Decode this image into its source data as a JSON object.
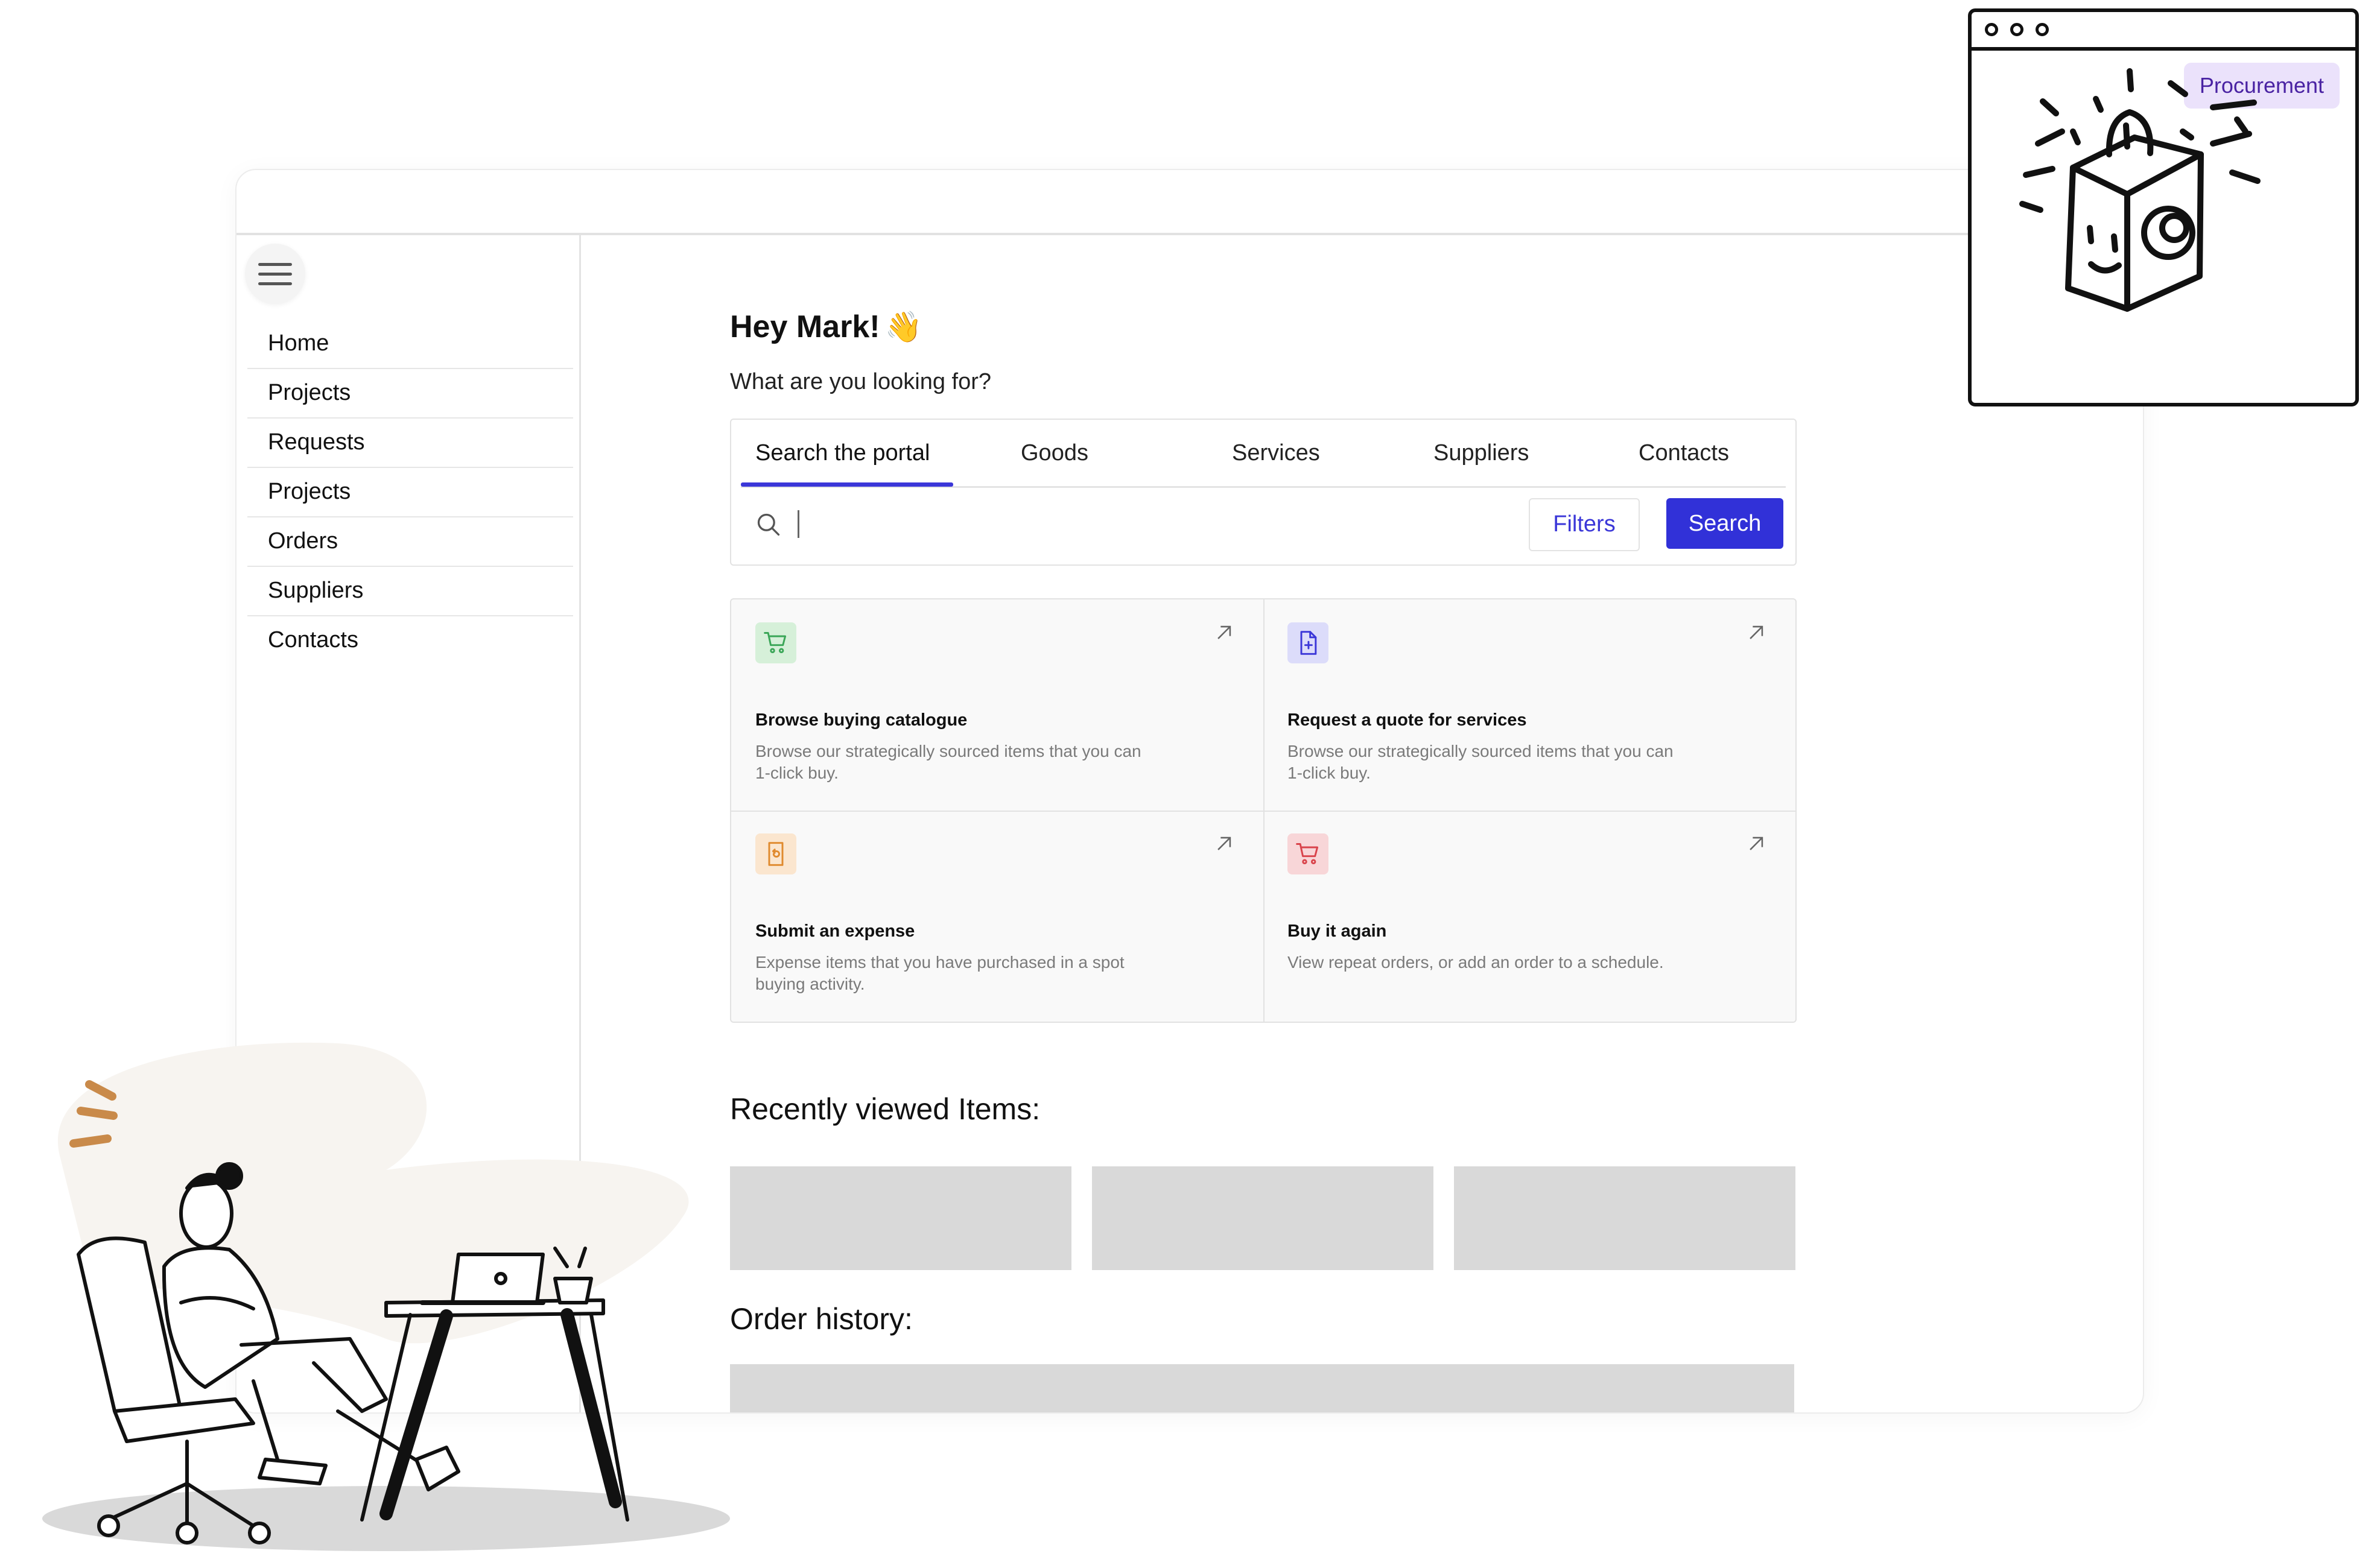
{
  "sidebar": {
    "menu_icon": "hamburger-menu-icon",
    "items": [
      "Home",
      "Projects",
      "Requests",
      "Projects",
      "Orders",
      "Suppliers",
      "Contacts"
    ]
  },
  "main": {
    "greeting": "Hey Mark!",
    "greeting_emoji": "👋",
    "question": "What are you looking for?",
    "search": {
      "tabs": [
        "Search the portal",
        "Goods",
        "Services",
        "Suppliers",
        "Contacts"
      ],
      "active_tab": "Search the portal",
      "placeholder": "",
      "filters_label": "Filters",
      "search_label": "Search",
      "accent": "#3131d8"
    },
    "cards": [
      {
        "title": "Browse buying catalogue",
        "description": "Browse our strategically sourced items that you can 1-click buy.",
        "icon": "cart-icon",
        "color": "#3aa657"
      },
      {
        "title": "Request a quote for services",
        "description": "Browse our strategically sourced items that you can 1-click buy.",
        "icon": "document-plus-icon",
        "color": "#3b37d8"
      },
      {
        "title": "Submit an expense",
        "description": "Expense items that you have purchased in a spot buying activity.",
        "icon": "receipt-icon",
        "color": "#e08a2e"
      },
      {
        "title": "Buy it again",
        "description": "View repeat orders, or add an order to a schedule.",
        "icon": "cart-icon",
        "color": "#d9434b"
      }
    ],
    "recently_viewed_title": "Recently viewed Items:",
    "order_history_title": "Order history:"
  },
  "procurement_window": {
    "badge": "Procurement",
    "badge_color": "#ebe2fb"
  }
}
